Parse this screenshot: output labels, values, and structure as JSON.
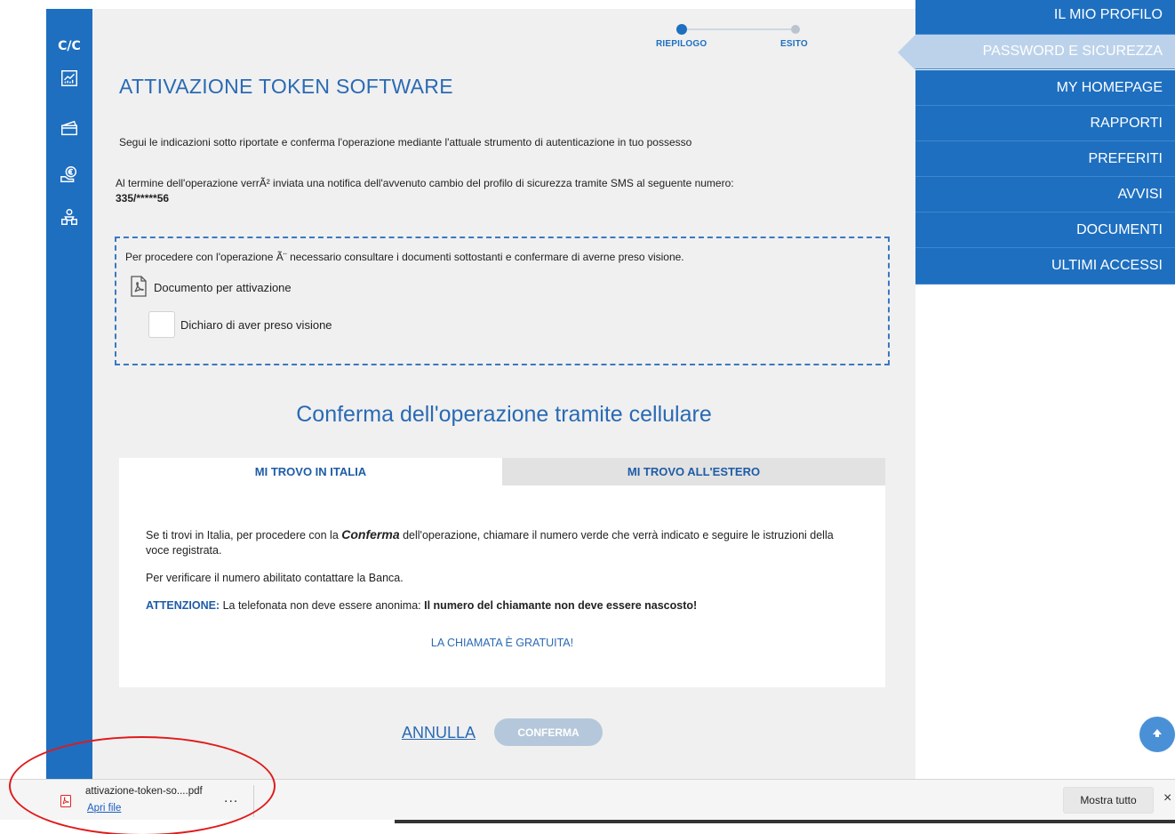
{
  "sidebar": {
    "items": [
      {
        "label": "C/C",
        "icon": "cc-icon"
      },
      {
        "icon": "chart-icon"
      },
      {
        "icon": "card-icon"
      },
      {
        "icon": "hand-euro-icon"
      },
      {
        "icon": "people-icon"
      }
    ]
  },
  "stepper": {
    "steps": [
      "RIEPILOGO",
      "ESITO"
    ],
    "active": "RIEPILOGO"
  },
  "page": {
    "title": "ATTIVAZIONE TOKEN SOFTWARE",
    "intro": "Segui le indicazioni sotto riportate e conferma l'operazione mediante l'attuale strumento di autenticazione in tuo possesso",
    "notify": "Al termine dell'operazione verrÃ² inviata una notifica dell'avvenuto cambio del profilo di sicurezza tramite SMS al seguente numero:",
    "phone": "335/*****56"
  },
  "documents": {
    "intro": "Per procedere con l'operazione Ã¨ necessario consultare i documenti sottostanti e confermare di averne preso visione.",
    "doc_link": "Documento per attivazione",
    "checkbox_label": "Dichiaro di aver preso visione",
    "checked": false
  },
  "confirm": {
    "heading": "Conferma dell'operazione tramite cellulare",
    "tabs": [
      "MI TROVO IN ITALIA",
      "MI TROVO ALL'ESTERO"
    ],
    "active_tab": "MI TROVO IN ITALIA",
    "p1_before": "Se ti trovi in Italia, per procedere con la ",
    "p1_bold": "Conferma",
    "p1_after": " dell'operazione, chiamare il numero verde che verrà indicato e seguire le istruzioni della voce registrata.",
    "p2": "Per verificare il numero abilitato contattare la Banca.",
    "att_label": "ATTENZIONE:",
    "att_text": " La telefonata non deve essere anonima: ",
    "att_bold": "Il numero del chiamante non deve essere nascosto!",
    "free_call": "LA CHIAMATA È GRATUITA!"
  },
  "actions": {
    "cancel": "ANNULLA",
    "confirm": "CONFERMA"
  },
  "right_menu": {
    "items": [
      "IL MIO PROFILO",
      "PASSWORD E SICUREZZA",
      "MY HOMEPAGE",
      "RAPPORTI",
      "PREFERITI",
      "AVVISI",
      "DOCUMENTI",
      "ULTIMI ACCESSI"
    ],
    "active": "PASSWORD E SICUREZZA"
  },
  "download_bar": {
    "file_name": "attivazione-token-so....pdf",
    "open_label": "Apri file",
    "more": "...",
    "show_all": "Mostra tutto",
    "close": "×"
  },
  "colors": {
    "brand_blue": "#1e6fc0",
    "title_blue": "#2a6ab4",
    "highlight": "#e01a1a"
  }
}
